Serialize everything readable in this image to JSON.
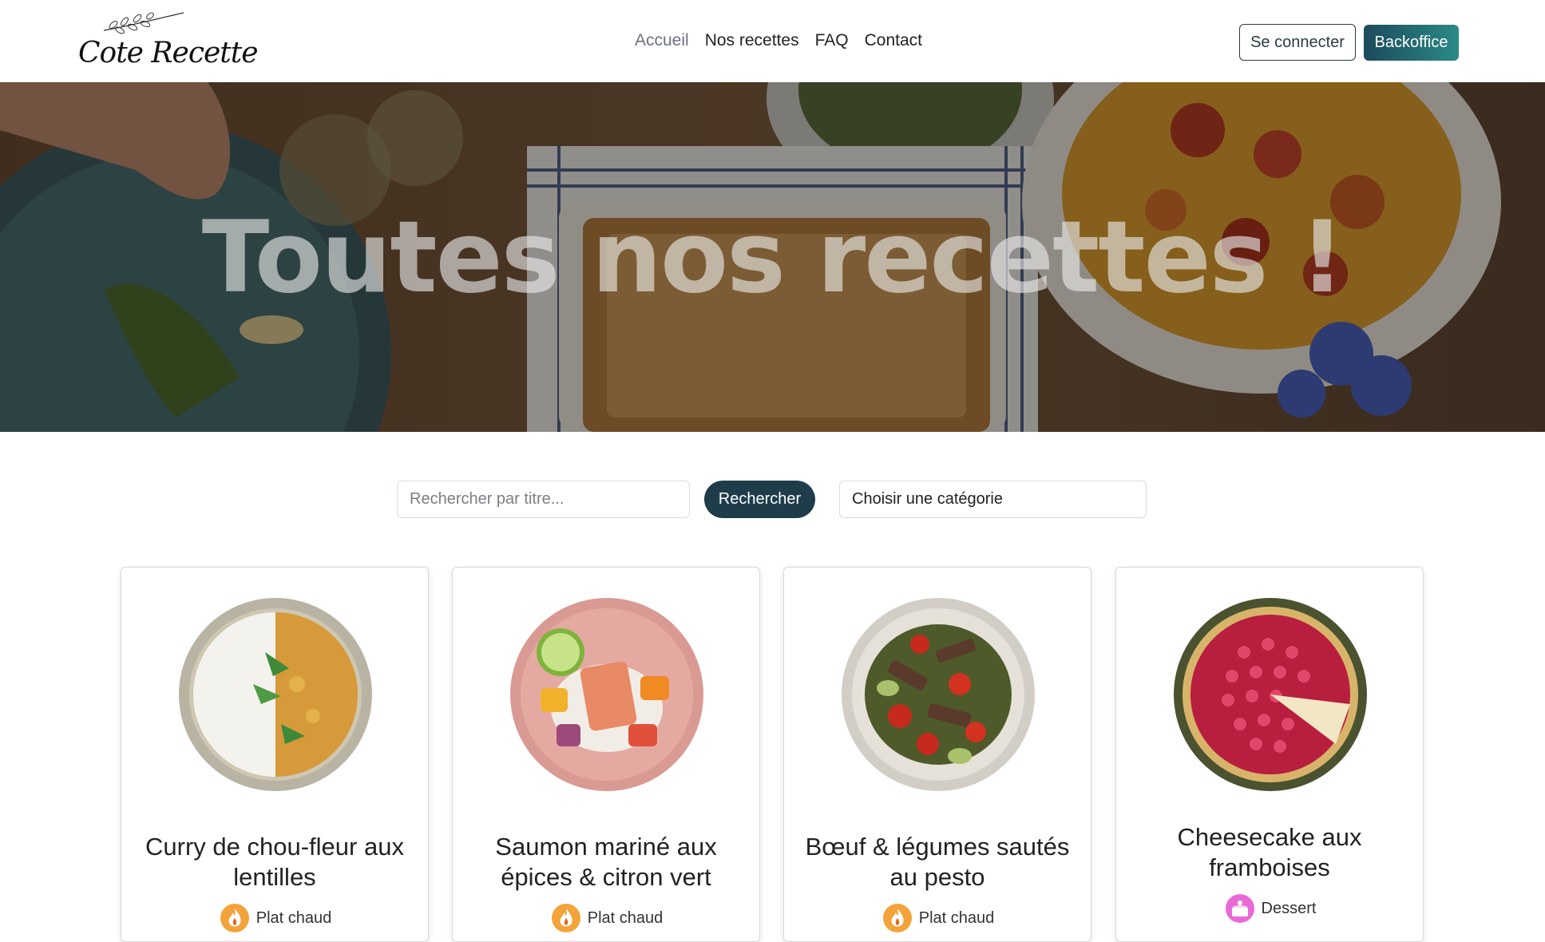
{
  "brand": {
    "logo_text": "Cote Recette"
  },
  "nav": {
    "items": [
      {
        "label": "Accueil",
        "active": true
      },
      {
        "label": "Nos recettes",
        "active": false
      },
      {
        "label": "FAQ",
        "active": false
      },
      {
        "label": "Contact",
        "active": false
      }
    ]
  },
  "header": {
    "login_label": "Se connecter",
    "backoffice_label": "Backoffice"
  },
  "hero": {
    "title": "Toutes nos recettes !"
  },
  "search": {
    "placeholder": "Rechercher par titre...",
    "button_label": "Rechercher",
    "category_select": "Choisir une catégorie"
  },
  "recipes": [
    {
      "title": "Curry de chou-fleur aux lentilles",
      "category": "Plat chaud",
      "category_icon": "flame-icon"
    },
    {
      "title": "Saumon mariné aux épices & citron vert",
      "category": "Plat chaud",
      "category_icon": "flame-icon"
    },
    {
      "title": "Bœuf & légumes sautés au pesto",
      "category": "Plat chaud",
      "category_icon": "flame-icon"
    },
    {
      "title": "Cheesecake aux framboises",
      "category": "Dessert",
      "category_icon": "cake-icon"
    }
  ],
  "colors": {
    "primary_dark": "#1f3c4a",
    "backoffice_gradient_start": "#1d4a5c",
    "backoffice_gradient_end": "#2a8a86"
  }
}
